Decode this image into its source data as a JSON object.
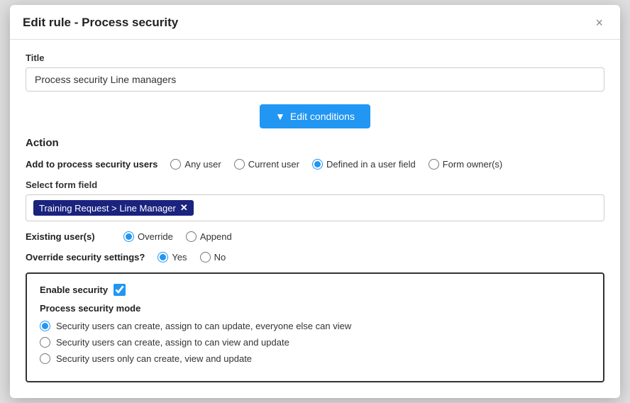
{
  "modal": {
    "title": "Edit rule - Process security",
    "close_icon": "×"
  },
  "title_field": {
    "label": "Title",
    "value": "Process security Line managers",
    "placeholder": "Process security Line managers"
  },
  "edit_conditions_btn": {
    "label": "Edit conditions",
    "icon": "▼"
  },
  "action": {
    "label": "Action"
  },
  "add_to_process": {
    "label": "Add to process security users",
    "options": [
      {
        "id": "any-user",
        "label": "Any user",
        "checked": false
      },
      {
        "id": "current-user",
        "label": "Current user",
        "checked": false
      },
      {
        "id": "defined-in-user-field",
        "label": "Defined in a user field",
        "checked": true
      },
      {
        "id": "form-owners",
        "label": "Form owner(s)",
        "checked": false
      }
    ]
  },
  "select_form_field": {
    "label": "Select form field",
    "tag_value": "Training Request > Line Manager"
  },
  "existing_users": {
    "label": "Existing user(s)",
    "options": [
      {
        "id": "override",
        "label": "Override",
        "checked": true
      },
      {
        "id": "append",
        "label": "Append",
        "checked": false
      }
    ]
  },
  "override_security": {
    "label": "Override security settings?",
    "options": [
      {
        "id": "yes",
        "label": "Yes",
        "checked": true
      },
      {
        "id": "no",
        "label": "No",
        "checked": false
      }
    ]
  },
  "security_box": {
    "enable_security_label": "Enable security",
    "enable_security_checked": true,
    "process_mode_label": "Process security mode",
    "modes": [
      {
        "id": "mode1",
        "label": "Security users can create, assign to can update, everyone else can view",
        "checked": true
      },
      {
        "id": "mode2",
        "label": "Security users can create, assign to can view and update",
        "checked": false
      },
      {
        "id": "mode3",
        "label": "Security users only can create, view and update",
        "checked": false
      }
    ]
  }
}
